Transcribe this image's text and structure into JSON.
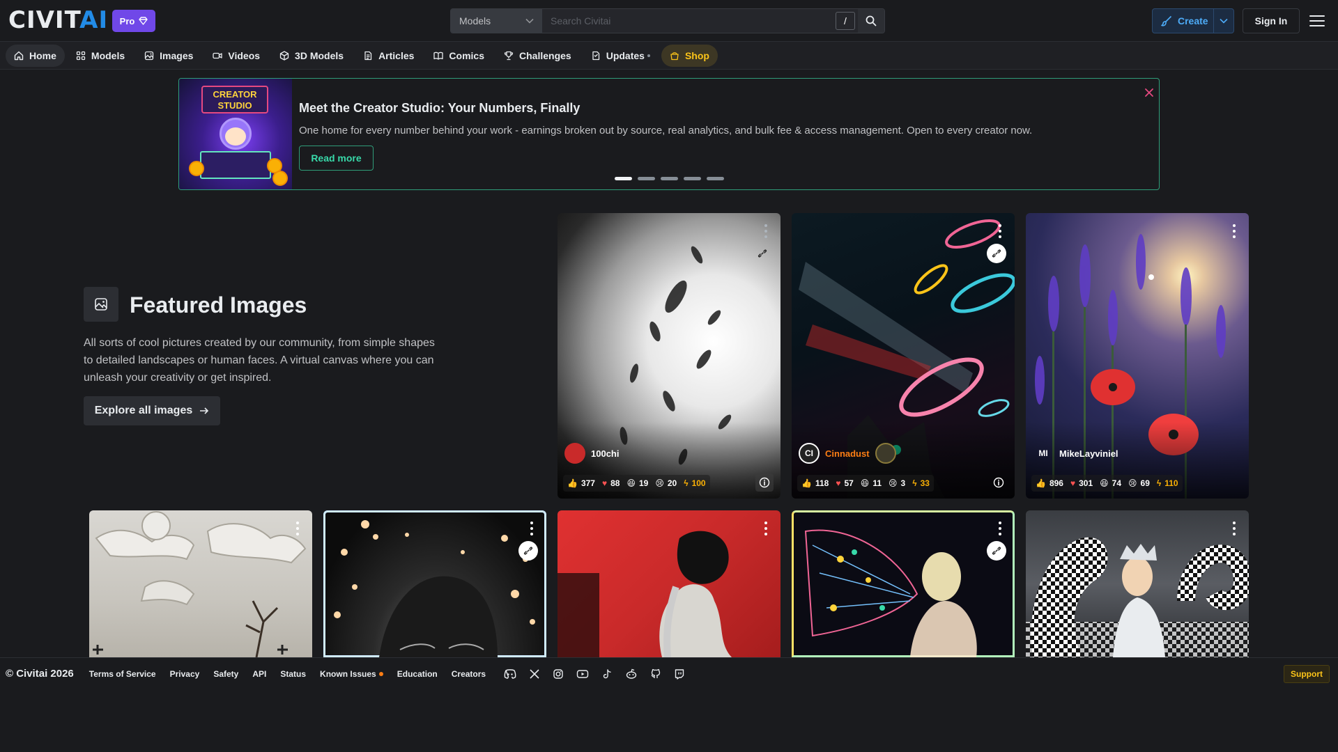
{
  "header": {
    "logo_white": "CIVIT",
    "logo_blue": "AI",
    "pro_label": "Pro",
    "search": {
      "type_selected": "Models",
      "placeholder": "Search Civitai",
      "shortcut": "/"
    },
    "create_label": "Create",
    "signin_label": "Sign In"
  },
  "nav": {
    "items": [
      {
        "label": "Home",
        "icon": "home-icon"
      },
      {
        "label": "Models",
        "icon": "grid-icon"
      },
      {
        "label": "Images",
        "icon": "image-icon"
      },
      {
        "label": "Videos",
        "icon": "video-icon"
      },
      {
        "label": "3D Models",
        "icon": "cube-icon"
      },
      {
        "label": "Articles",
        "icon": "article-icon"
      },
      {
        "label": "Comics",
        "icon": "book-icon"
      },
      {
        "label": "Challenges",
        "icon": "trophy-icon"
      },
      {
        "label": "Updates",
        "icon": "updates-icon"
      },
      {
        "label": "Shop",
        "icon": "basket-icon"
      }
    ]
  },
  "banner": {
    "image_sign": "CREATOR STUDIO",
    "title": "Meet the Creator Studio: Your Numbers, Finally",
    "description": "One home for every number behind your work - earnings broken out by source, real analytics, and bulk fee & access management. Open to every creator now.",
    "cta": "Read more",
    "slides": 5,
    "active_slide": 0
  },
  "featured": {
    "title": "Featured Images",
    "description": "All sorts of cool pictures created by our community, from simple shapes to detailed landscapes or human faces. A virtual canvas where you can unleash your creativity or get inspired.",
    "cta": "Explore all images"
  },
  "cards_top": [
    {
      "user": "100chi",
      "avatar_text": "",
      "likes": "377",
      "hearts": "88",
      "laughs": "19",
      "cries": "20",
      "buzz": "100",
      "user_color": "#ffffff"
    },
    {
      "user": "Cinnadust",
      "avatar_text": "CI",
      "likes": "118",
      "hearts": "57",
      "laughs": "11",
      "cries": "3",
      "buzz": "33",
      "user_color": "#fd7e14"
    },
    {
      "user": "MikeLayviniel",
      "avatar_text": "MI",
      "likes": "896",
      "hearts": "301",
      "laughs": "74",
      "cries": "69",
      "buzz": "110",
      "user_color": "#ffffff"
    }
  ],
  "footer": {
    "copyright": "© Civitai 2026",
    "links": [
      "Terms of Service",
      "Privacy",
      "Safety",
      "API",
      "Status",
      "Known Issues",
      "Education",
      "Creators"
    ],
    "socials": [
      "discord-icon",
      "x-icon",
      "instagram-icon",
      "youtube-icon",
      "tiktok-icon",
      "reddit-icon",
      "github-icon",
      "twitch-icon"
    ],
    "support_label": "Support"
  },
  "colors": {
    "accent_blue": "#228be6",
    "pro_purple": "#7048e8",
    "banner_border": "#2f9e7a",
    "shop_gold": "#fcc419"
  }
}
